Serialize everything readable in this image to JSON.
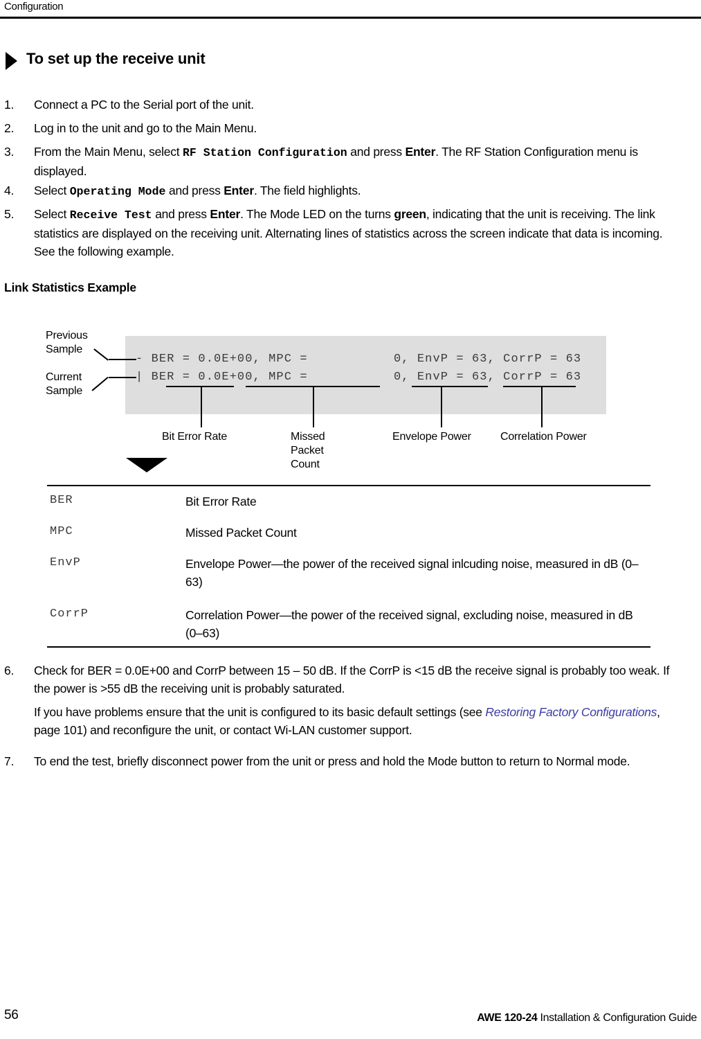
{
  "header": {
    "running_head": "Configuration"
  },
  "procedure": {
    "title": "To set up the receive unit",
    "steps": [
      {
        "num": "1.",
        "parts": [
          {
            "t": "plain",
            "v": "Connect a PC to the Serial port of the unit."
          }
        ]
      },
      {
        "num": "2.",
        "parts": [
          {
            "t": "plain",
            "v": "Log in to the unit and go to the Main Menu."
          }
        ]
      },
      {
        "num": "3.",
        "parts": [
          {
            "t": "plain",
            "v": "From the Main Menu, select "
          },
          {
            "t": "mono",
            "v": "RF Station Configuration"
          },
          {
            "t": "plain",
            "v": " and press "
          },
          {
            "t": "kbd",
            "v": "Enter"
          },
          {
            "t": "plain",
            "v": ". The RF Station Configuration menu is displayed."
          }
        ]
      },
      {
        "num": "4.",
        "parts": [
          {
            "t": "plain",
            "v": "Select "
          },
          {
            "t": "mono",
            "v": "Operating Mode"
          },
          {
            "t": "plain",
            "v": " and press "
          },
          {
            "t": "kbd",
            "v": "Enter"
          },
          {
            "t": "plain",
            "v": ". The field highlights."
          }
        ]
      },
      {
        "num": "5.",
        "parts": [
          {
            "t": "plain",
            "v": "Select "
          },
          {
            "t": "mono",
            "v": "Receive Test"
          },
          {
            "t": "plain",
            "v": " and press "
          },
          {
            "t": "kbd",
            "v": "Enter"
          },
          {
            "t": "plain",
            "v": ". The Mode LED on the turns "
          },
          {
            "t": "bold",
            "v": "green"
          },
          {
            "t": "plain",
            "v": ", indicating that the unit is receiving. The link statistics are displayed on the receiving unit. Alternating lines of statistics across the screen indicate that data is incoming. See the following example."
          }
        ]
      }
    ],
    "steps_after": [
      {
        "num": "6.",
        "paragraphs": [
          {
            "parts": [
              {
                "t": "plain",
                "v": "Check for BER = 0.0E+00 and CorrP between 15 – 50 dB. If the CorrP is <15 dB the receive signal is probably too weak. If the power is >55 dB the receiving unit is probably saturated."
              }
            ]
          },
          {
            "parts": [
              {
                "t": "plain",
                "v": "If you have problems ensure that the unit is configured to its basic default settings (see "
              },
              {
                "t": "xref",
                "v": "Restoring Factory Configurations"
              },
              {
                "t": "plain",
                "v": ", page 101) and reconfigure the unit, or contact Wi-LAN customer support."
              }
            ]
          }
        ]
      },
      {
        "num": "7.",
        "paragraphs": [
          {
            "parts": [
              {
                "t": "plain",
                "v": "To end the test, briefly disconnect power from the unit or press and hold the Mode button to return to Normal mode."
              }
            ]
          }
        ]
      }
    ]
  },
  "example": {
    "subhead": "Link Statistics Example",
    "side_labels": {
      "previous": "Previous\nSample",
      "current": "Current\nSample"
    },
    "terminal_lines": [
      "- BER = 0.0E+00, MPC =           0, EnvP = 63, CorrP = 63",
      "| BER = 0.0E+00, MPC =           0, EnvP = 63, CorrP = 63"
    ],
    "callouts": [
      {
        "label": "Bit Error Rate"
      },
      {
        "label": "Missed\nPacket\nCount"
      },
      {
        "label": "Envelope Power"
      },
      {
        "label": "Correlation Power"
      }
    ],
    "screen_bg": "#dedede"
  },
  "definitions": {
    "rows": [
      {
        "term": "BER",
        "desc": "Bit Error Rate"
      },
      {
        "term": "MPC",
        "desc": "Missed Packet Count"
      },
      {
        "term": "EnvP",
        "desc": "Envelope Power—the power of the received signal inlcuding noise, measured in dB (0–63)"
      },
      {
        "term": "CorrP",
        "desc": "Correlation Power—the power of the received signal, excluding noise, measured in dB (0–63)"
      }
    ]
  },
  "footer": {
    "page_number": "56",
    "guide_title_bold": "AWE 120-24",
    "guide_title_rest": " Installation & Configuration Guide"
  },
  "colors": {
    "xref_link": "#3b3ba4",
    "terminal_text": "#3a3a3a",
    "screen_background": "#dedede",
    "rule": "#000000"
  }
}
